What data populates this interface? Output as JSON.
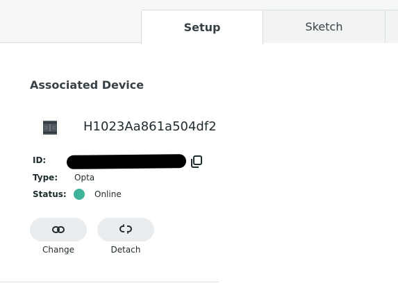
{
  "tabs": [
    {
      "label": "Setup",
      "active": true
    },
    {
      "label": "Sketch",
      "active": false
    }
  ],
  "section": {
    "title": "Associated Device"
  },
  "device": {
    "icon": "board-icon",
    "name": "H1023Aa861a504df2"
  },
  "fields": {
    "id_label": "ID:",
    "type_label": "Type:",
    "type_value": "Opta",
    "status_label": "Status:",
    "status_value": "Online",
    "status_color": "#3eb39a"
  },
  "actions": [
    {
      "label": "Change",
      "icon": "link-icon"
    },
    {
      "label": "Detach",
      "icon": "unlink-icon"
    }
  ],
  "colors": {
    "accent_online": "#3eb39a",
    "button_bg": "#e9edf0",
    "text": "#374146"
  }
}
